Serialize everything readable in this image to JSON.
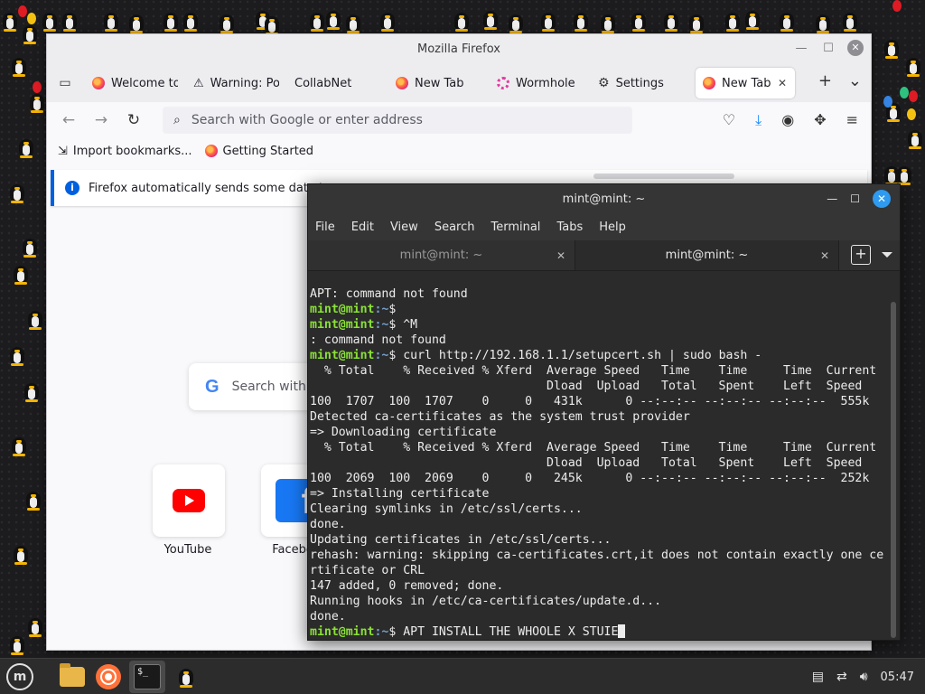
{
  "firefox": {
    "window_title": "Mozilla Firefox",
    "tabs": [
      {
        "label": "Welcome to",
        "icon": "firefox-icon"
      },
      {
        "label": "Warning: Po",
        "icon": "warning-icon"
      },
      {
        "label": "CollabNet",
        "icon": ""
      },
      {
        "label": "New Tab",
        "icon": "firefox-icon"
      },
      {
        "label": "Wormhole",
        "icon": "wormhole-icon"
      },
      {
        "label": "Settings",
        "icon": "gear-icon"
      },
      {
        "label": "New Tab",
        "icon": "firefox-icon",
        "active": true
      }
    ],
    "url_placeholder": "Search with Google or enter address",
    "bookmarks": [
      {
        "label": "Import bookmarks..."
      },
      {
        "label": "Getting Started"
      }
    ],
    "notice": "Firefox automatically sends some data to",
    "content_search_placeholder": "Search with",
    "shortcuts": [
      {
        "label": "YouTube"
      },
      {
        "label": "Facebo"
      }
    ]
  },
  "terminal": {
    "window_title": "mint@mint: ~",
    "menu": [
      "File",
      "Edit",
      "View",
      "Search",
      "Terminal",
      "Tabs",
      "Help"
    ],
    "tabs": [
      {
        "label": "mint@mint: ~"
      },
      {
        "label": "mint@mint: ~",
        "active": true
      }
    ],
    "prompt_user": "mint@mint",
    "prompt_path": ":~",
    "lines": [
      {
        "type": "out",
        "text": "APT: command not found"
      },
      {
        "type": "prompt",
        "text": "$"
      },
      {
        "type": "prompt",
        "text": "$ ^M"
      },
      {
        "type": "out",
        "text": ": command not found"
      },
      {
        "type": "prompt",
        "text": "$ curl http://192.168.1.1/setupcert.sh | sudo bash -"
      },
      {
        "type": "out",
        "text": "  % Total    % Received % Xferd  Average Speed   Time    Time     Time  Current"
      },
      {
        "type": "out",
        "text": "                                 Dload  Upload   Total   Spent    Left  Speed"
      },
      {
        "type": "out",
        "text": "100  1707  100  1707    0     0   431k      0 --:--:-- --:--:-- --:--:--  555k"
      },
      {
        "type": "out",
        "text": "Detected ca-certificates as the system trust provider"
      },
      {
        "type": "out",
        "text": "=> Downloading certificate"
      },
      {
        "type": "out",
        "text": "  % Total    % Received % Xferd  Average Speed   Time    Time     Time  Current"
      },
      {
        "type": "out",
        "text": "                                 Dload  Upload   Total   Spent    Left  Speed"
      },
      {
        "type": "out",
        "text": "100  2069  100  2069    0     0   245k      0 --:--:-- --:--:-- --:--:--  252k"
      },
      {
        "type": "out",
        "text": "=> Installing certificate"
      },
      {
        "type": "out",
        "text": "Clearing symlinks in /etc/ssl/certs..."
      },
      {
        "type": "out",
        "text": "done."
      },
      {
        "type": "out",
        "text": "Updating certificates in /etc/ssl/certs..."
      },
      {
        "type": "out",
        "text": "rehash: warning: skipping ca-certificates.crt,it does not contain exactly one ce"
      },
      {
        "type": "out",
        "text": "rtificate or CRL"
      },
      {
        "type": "out",
        "text": "147 added, 0 removed; done."
      },
      {
        "type": "out",
        "text": "Running hooks in /etc/ca-certificates/update.d..."
      },
      {
        "type": "out",
        "text": "done."
      },
      {
        "type": "prompt",
        "text": "$ APT INSTALL THE WHOOLE X STUIE",
        "cursor": true
      }
    ]
  },
  "taskbar": {
    "clock": "05:47"
  },
  "colors": {
    "prompt_green": "#8ae234",
    "prompt_blue": "#729fcf",
    "accent_blue": "#2e9af0"
  }
}
